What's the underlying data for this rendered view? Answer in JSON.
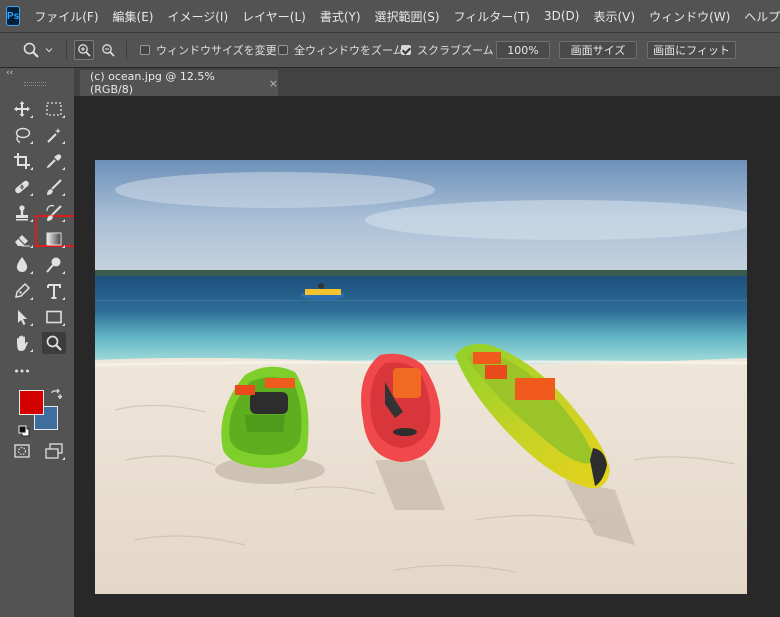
{
  "app": {
    "logo": "Ps"
  },
  "menu": [
    {
      "label": "ファイル(F)"
    },
    {
      "label": "編集(E)"
    },
    {
      "label": "イメージ(I)"
    },
    {
      "label": "レイヤー(L)"
    },
    {
      "label": "書式(Y)"
    },
    {
      "label": "選択範囲(S)"
    },
    {
      "label": "フィルター(T)"
    },
    {
      "label": "3D(D)"
    },
    {
      "label": "表示(V)"
    },
    {
      "label": "ウィンドウ(W)"
    },
    {
      "label": "ヘルプ(H)"
    }
  ],
  "options": {
    "tool_icon": "zoom-icon",
    "resize_windows_label": "ウィンドウサイズを変更",
    "resize_windows_checked": false,
    "zoom_all_label": "全ウィンドウをズーム",
    "zoom_all_checked": false,
    "scrubby_label": "スクラブズーム",
    "scrubby_checked": true,
    "zoom_value": "100%",
    "fit_screen_label": "画面サイズ",
    "fill_screen_label": "画面にフィット"
  },
  "toolbar": {
    "collapse_glyph": "‹‹",
    "selected_tool": "zoom-tool",
    "highlighted_tool": "eyedropper-tool",
    "foreground_color": "#d40000",
    "background_color": "#3e6e9e"
  },
  "document": {
    "tab_title": "(c) ocean.jpg @ 12.5% (RGB/8)",
    "close_glyph": "×"
  },
  "colors": {
    "chrome": "#535353",
    "workspace": "#282828",
    "highlight_box": "#d81e1e"
  }
}
